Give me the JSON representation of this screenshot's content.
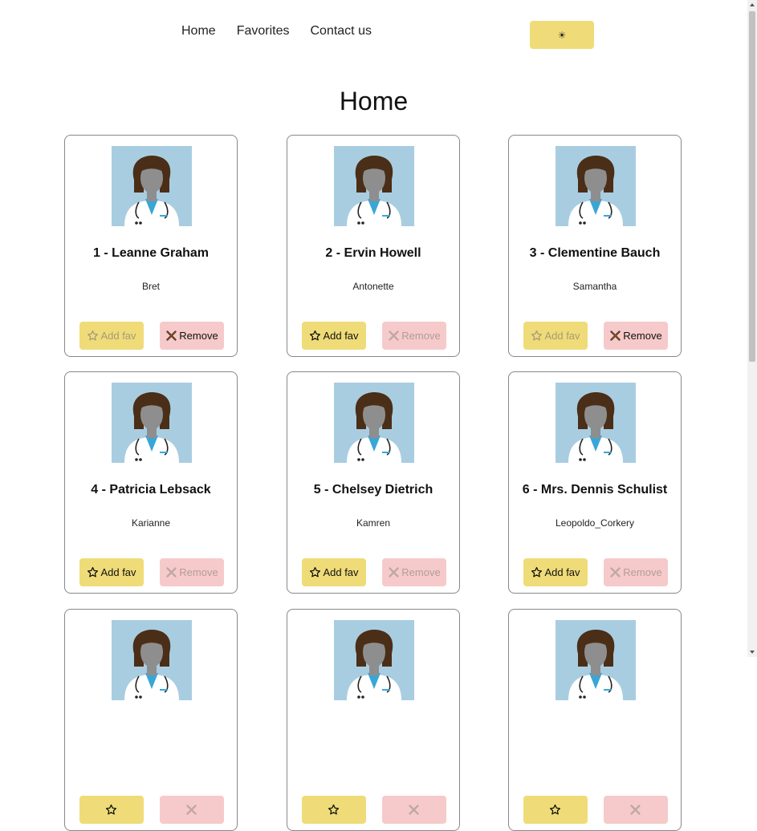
{
  "nav": {
    "items": [
      {
        "label": "Home"
      },
      {
        "label": "Favorites"
      },
      {
        "label": "Contact us"
      }
    ],
    "theme_icon": "sun-icon",
    "theme_glyph": "☀"
  },
  "page": {
    "title": "Home"
  },
  "colors": {
    "accent_yellow": "#efdc78",
    "remove_pink": "#f6caca",
    "avatar_bg": "#a9cde0"
  },
  "users": [
    {
      "name": "1 - Leanne Graham",
      "username": "Bret",
      "add_label": "Add fav",
      "remove_label": "Remove",
      "is_favorite": true
    },
    {
      "name": "2 - Ervin Howell",
      "username": "Antonette",
      "add_label": "Add fav",
      "remove_label": "Remove",
      "is_favorite": false
    },
    {
      "name": "3 - Clementine Bauch",
      "username": "Samantha",
      "add_label": "Add fav",
      "remove_label": "Remove",
      "is_favorite": true
    },
    {
      "name": "4 - Patricia Lebsack",
      "username": "Karianne",
      "add_label": "Add fav",
      "remove_label": "Remove",
      "is_favorite": false
    },
    {
      "name": "5 - Chelsey Dietrich",
      "username": "Kamren",
      "add_label": "Add fav",
      "remove_label": "Remove",
      "is_favorite": false
    },
    {
      "name": "6 - Mrs. Dennis Schulist",
      "username": "Leopoldo_Corkery",
      "add_label": "Add fav",
      "remove_label": "Remove",
      "is_favorite": false
    },
    {
      "name": "",
      "username": "",
      "add_label": "",
      "remove_label": "",
      "is_favorite": false
    },
    {
      "name": "",
      "username": "",
      "add_label": "",
      "remove_label": "",
      "is_favorite": false
    },
    {
      "name": "",
      "username": "",
      "add_label": "",
      "remove_label": "",
      "is_favorite": false
    }
  ]
}
